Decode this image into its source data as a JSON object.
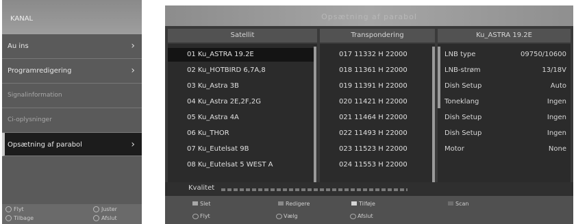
{
  "menu": {
    "title": "KANAL",
    "items": [
      {
        "label": "Au ins",
        "has_submenu": true,
        "selected": false,
        "dim": false
      },
      {
        "label": "Programredigering",
        "has_submenu": true,
        "selected": false,
        "dim": false
      },
      {
        "label": "Signalinformation",
        "has_submenu": false,
        "selected": false,
        "dim": true
      },
      {
        "label": "Ci-oplysninger",
        "has_submenu": false,
        "selected": false,
        "dim": true
      },
      {
        "label": "Opsætning af parabol",
        "has_submenu": true,
        "selected": true,
        "dim": false
      }
    ],
    "footer": {
      "move": "Flyt",
      "adjust": "Juster",
      "back": "Tilbage",
      "exit": "Afslut"
    }
  },
  "dish": {
    "header_title": "Opsætning af parabol",
    "columns": {
      "satellite": "Satellit",
      "transponder": "Transpondering",
      "settings": "Ku_ASTRA 19.2E"
    },
    "satellites": [
      "01 Ku_ASTRA 19.2E",
      "02 Ku_HOTBIRD 6,7A,8",
      "03 Ku_Astra 3B",
      "04 Ku_Astra 2E,2F,2G",
      "05 Ku_Astra 4A",
      "06 Ku_THOR",
      "07 Ku_Eutelsat 9B",
      "08 Ku_Eutelsat 5 WEST A"
    ],
    "transponders": [
      "017 11332 H 22000",
      "018 11361 H 22000",
      "019 11391 H 22000",
      "020 11421 H 22000",
      "021 11464 H 22000",
      "022 11493 H 22000",
      "023 11523 H 22000",
      "024 11553 H 22000"
    ],
    "selected_index": 0,
    "settings": [
      {
        "label": "LNB type",
        "value": "09750/10600"
      },
      {
        "label": "LNB-strøm",
        "value": "13/18V"
      },
      {
        "label": "Dish Setup",
        "value": "Auto"
      },
      {
        "label": "Toneklang",
        "value": "Ingen"
      },
      {
        "label": "Dish Setup",
        "value": "Ingen"
      },
      {
        "label": "Dish Setup",
        "value": "Ingen"
      },
      {
        "label": "Motor",
        "value": "None"
      }
    ],
    "quality_label": "Kvalitet",
    "buttons": {
      "delete": "Slet",
      "edit": "Redigere",
      "add": "Tilføje",
      "scan": "Scan",
      "move": "Flyt",
      "select": "Vælg",
      "exit": "Afslut"
    },
    "colors": {
      "delete": "#a8a8a8",
      "edit": "#8a8a8a",
      "add": "#d6d6d6",
      "scan": "#6e6e6e"
    }
  }
}
